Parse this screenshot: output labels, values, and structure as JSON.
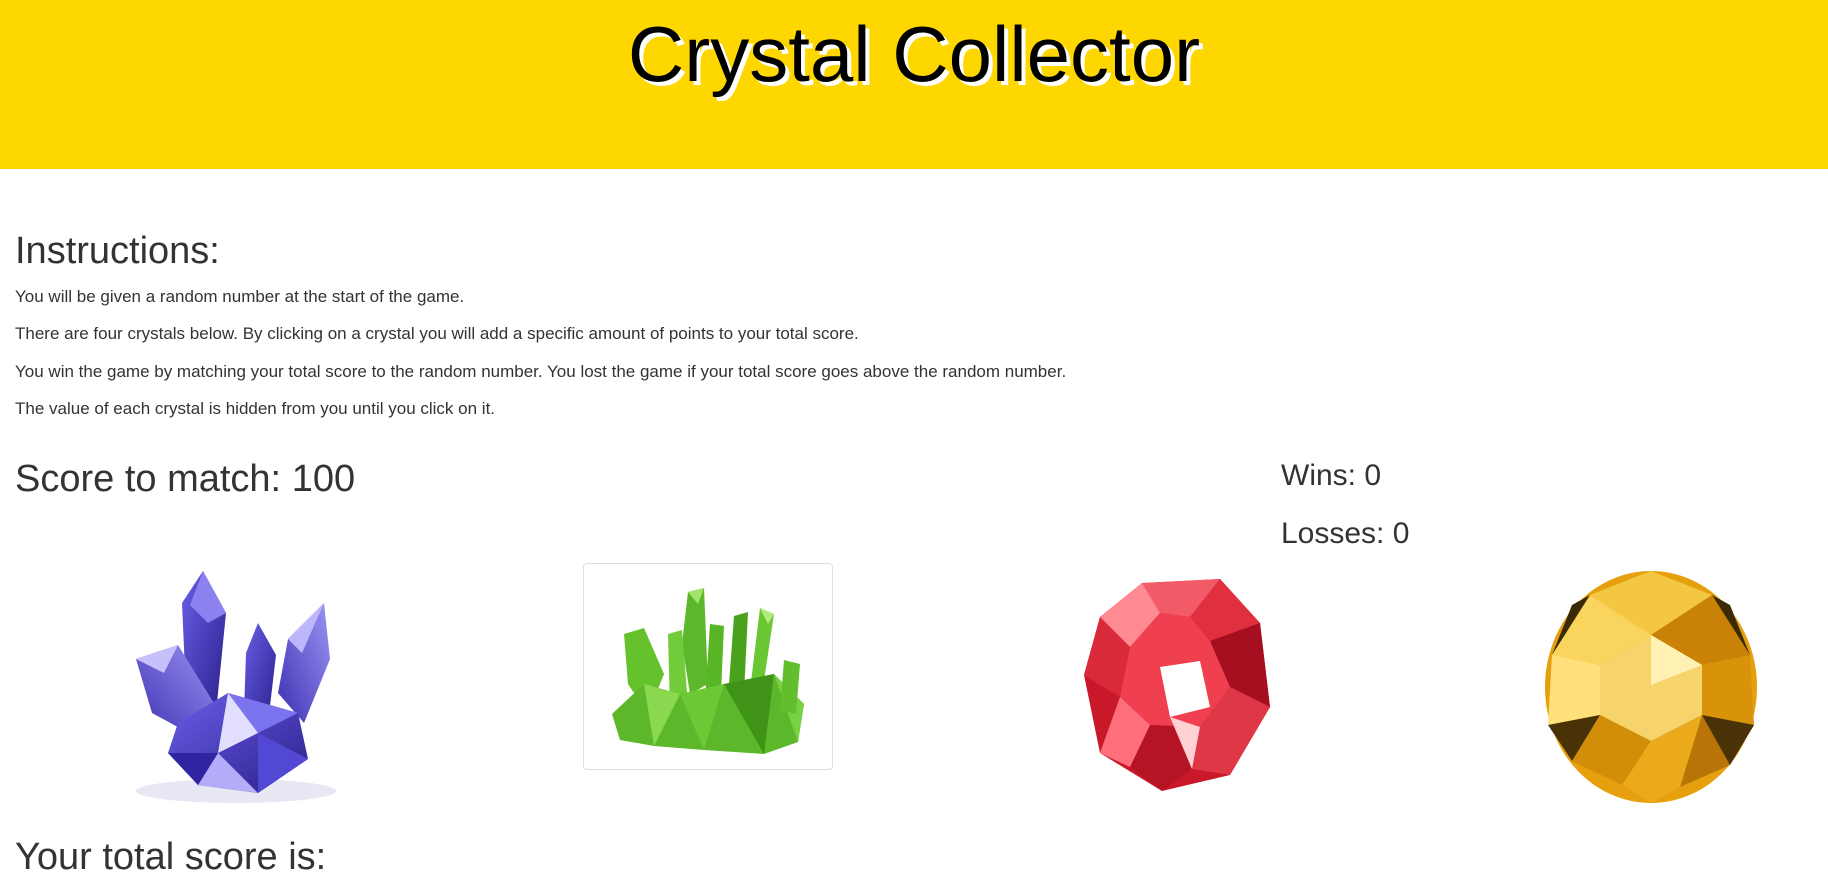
{
  "header": {
    "title": "Crystal Collector",
    "background_color": "#FFD700"
  },
  "instructions": {
    "heading": "Instructions:",
    "lines": [
      "You will be given a random number at the start of the game.",
      "There are four crystals below. By clicking on a crystal you will add a specific amount of points to your total score.",
      "You win the game by matching your total score to the random number. You lost the game if your total score goes above the random number.",
      "The value of each crystal is hidden from you until you click on it."
    ]
  },
  "game": {
    "score_to_match_label": "Score to match:",
    "score_to_match_value": "100",
    "wins_label": "Wins:",
    "wins_value": "0",
    "losses_label": "Losses:",
    "losses_value": "0",
    "total_score_label": "Your total score is:",
    "total_score_value": ""
  },
  "crystals": [
    {
      "name": "blue-crystal",
      "color": "#4a3fc0"
    },
    {
      "name": "green-crystal",
      "color": "#5cb82a"
    },
    {
      "name": "red-crystal",
      "color": "#d81f2f"
    },
    {
      "name": "yellow-crystal",
      "color": "#e6a00e"
    }
  ]
}
